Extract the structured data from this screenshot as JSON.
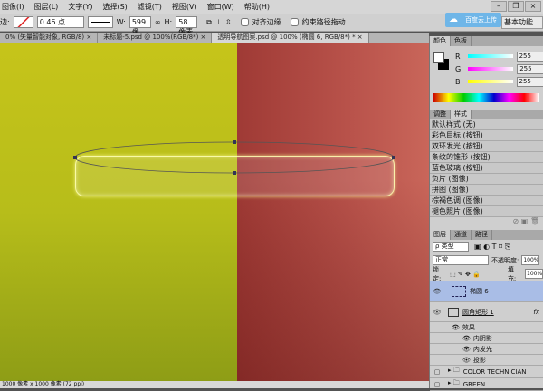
{
  "menu": [
    "图像(I)",
    "图层(L)",
    "文字(Y)",
    "选择(S)",
    "滤镜(T)",
    "视图(V)",
    "窗口(W)",
    "帮助(H)"
  ],
  "window_controls": [
    "–",
    "❐",
    "×"
  ],
  "options": {
    "label": "边:",
    "stroke_width": "0.46 点",
    "w_label": "W:",
    "w_value": "599 像",
    "link": "∞",
    "h_label": "H:",
    "h_value": "58 像素",
    "align_edges": "对齐边缘",
    "constrain_path": "约束路径拖动"
  },
  "cloud_button": "百度云上传",
  "workspace": "基本功能",
  "tabs": [
    "0% (矢量智能对象, RGB/8) ×",
    "未标题-5.psd @ 100%(RGB/8*) ×",
    "透明导航图案.psd @ 100% (椭圆 6, RGB/8*) * ×"
  ],
  "status": "1000 像素 x 1000 像素 (72 ppi)",
  "colors": {
    "left_canvas": "#b9bd1a",
    "right_canvas": "#b9534b",
    "layer_selected": "#a9bde6"
  },
  "color_panel": {
    "tabs": [
      "颜色",
      "色板"
    ],
    "channels": [
      {
        "label": "R",
        "value": "255"
      },
      {
        "label": "G",
        "value": "255"
      },
      {
        "label": "B",
        "value": "255"
      }
    ]
  },
  "styles_panel": {
    "tabs": [
      "调整",
      "样式"
    ],
    "items": [
      "默认样式 (无)",
      "彩色目标 (按钮)",
      "双环发光 (按钮)",
      "条纹的锥形 (按钮)",
      "蓝色玻璃 (按钮)",
      "负片 (图像)",
      "拼图 (图像)",
      "棕褐色调 (图像)",
      "褪色照片 (图像)"
    ]
  },
  "layers_panel": {
    "tabs": [
      "图层",
      "通道",
      "路径"
    ],
    "filter": "ρ 类型",
    "blend": "正常",
    "opacity_label": "不透明度:",
    "opacity": "100%",
    "lock_label": "锁定:",
    "fill_label": "填充:",
    "fill": "100%",
    "layers": [
      {
        "name": "椭圆 6",
        "selected": true
      },
      {
        "name": "圆角矩形 1",
        "fx": "fx"
      }
    ],
    "effects": [
      "效果",
      "内阴影",
      "内发光",
      "投影"
    ],
    "groups": [
      "COLOR TECHNICIAN",
      "GREEN"
    ]
  }
}
